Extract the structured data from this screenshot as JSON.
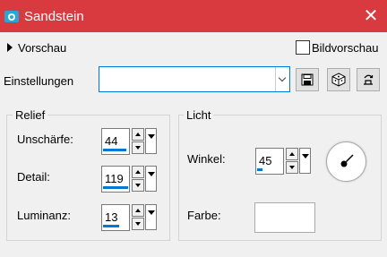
{
  "window": {
    "title": "Sandstein",
    "close_glyph": "✕"
  },
  "preview": {
    "label": "Vorschau",
    "checkbox_label": "Bildvorschau",
    "checked": false
  },
  "settings": {
    "label": "Einstellungen",
    "value": ""
  },
  "relief": {
    "title": "Relief",
    "fields": [
      {
        "label": "Unschärfe:",
        "value": "44"
      },
      {
        "label": "Detail:",
        "value": "119"
      },
      {
        "label": "Luminanz:",
        "value": "13"
      }
    ]
  },
  "licht": {
    "title": "Licht",
    "angle": {
      "label": "Winkel:",
      "value": "45"
    },
    "color": {
      "label": "Farbe:",
      "value": "#ffffff"
    }
  },
  "colors": {
    "titlebar": "#d93a3f",
    "accent": "#0078d7"
  },
  "icons": [
    "camera-icon",
    "close-icon",
    "save-icon",
    "dice-icon",
    "reset-icon",
    "dial-icon"
  ]
}
